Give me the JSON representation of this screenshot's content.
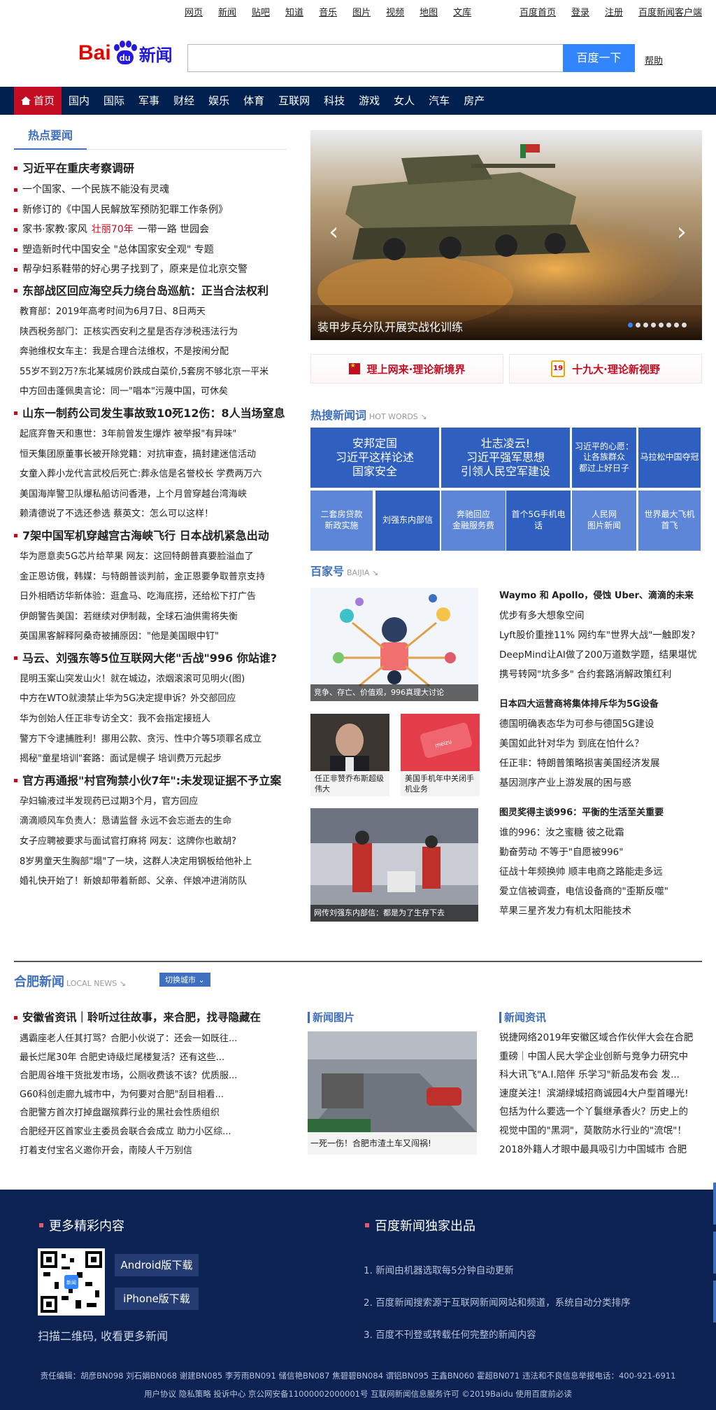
{
  "topnav": {
    "items": [
      "网页",
      "新闻",
      "贴吧",
      "知道",
      "音乐",
      "图片",
      "视频",
      "地图",
      "文库"
    ],
    "right": [
      "百度首页",
      "登录",
      "注册",
      "百度新闻客户端"
    ]
  },
  "header": {
    "logo_bai": "Bai",
    "logo_du": "du",
    "logo_xinwen": "新闻",
    "search_button": "百度一下",
    "help": "帮助",
    "search_value": ""
  },
  "mainnav": {
    "items": [
      "首页",
      "国内",
      "国际",
      "军事",
      "财经",
      "娱乐",
      "体育",
      "互联网",
      "科技",
      "游戏",
      "女人",
      "汽车",
      "房产"
    ]
  },
  "hot_news": {
    "title": "热点要闻",
    "top": [
      {
        "text": "习近平在重庆考察调研",
        "bold": true
      },
      {
        "text": "一个国家、一个民族不能没有灵魂"
      },
      {
        "text": "新修订的《中国人民解放军预防犯罪工作条例》"
      },
      {
        "text": "家书·家教·家风",
        "red": "壮丽70年",
        "rest": "一带一路  世园会"
      },
      {
        "text": "塑造新时代中国安全 \"总体国家安全观\" 专题"
      },
      {
        "text": "帮孕妇系鞋带的好心男子找到了，原来是位北京交警"
      }
    ],
    "groups": [
      {
        "head": "东部战区回应海空兵力绕台岛巡航：正当合法权利",
        "items": [
          "教育部：2019年高考时间为6月7日、8日两天",
          "陕西税务部门：正核实西安利之星是否存涉税违法行为",
          "奔驰维权女车主：我是合理合法维权，不是按闹分配",
          "55岁不到2万?东北某城房价跌成白菜价,5套房不够北京一平米",
          "中方回击蓬佩奥言论：同一\"唱本\"污蔑中国，可休矣"
        ]
      },
      {
        "head": "山东一制药公司发生事故致10死12伤：8人当场窒息",
        "items": [
          "起底弃鲁天和惠世：3年前曾发生爆炸 被举报\"有异味\"",
          "恒天集团原董事长被开除党籍：对抗审查，搞封建迷信活动",
          "女童入葬小龙代言武校后死亡:葬永信是名誉校长 学费两万六",
          "美国海岸警卫队爆私船访问香港，上个月曾穿越台湾海峡",
          "赖清德说了不选还参选 蔡英文：怎么可以这样！"
        ]
      },
      {
        "head": "7架中国军机穿越宫古海峡飞行 日本战机紧急出动",
        "items": [
          "华为愿意卖5G芯片给苹果 网友：这回特朗普真要脸溢血了",
          "金正恩访俄，韩媒：与特朗普谈判前，金正恩要争取普京支持",
          "日外相晒访华新体验：逛盒马、吃海底捞，还给松下打广告",
          "伊朗警告美国：若继续对伊制裁，全球石油供需将失衡",
          "英国黑客解释阿桑奇被捕原因：\"他是美国眼中钉\""
        ]
      },
      {
        "head": "马云、刘强东等5位互联网大佬\"舌战\"996 你站谁?",
        "items": [
          "昆明玉案山突发山火！就在城边，浓烟滚滚可见明火(图)",
          "中方在WTO就澳禁止华为5G决定提申诉？外交部回应",
          "华为创始人任正非专访全文：我不会指定接班人",
          "警方下令逮捕胜利！挪用公款、贪污、性中介等5项罪名成立",
          "揭秘\"童星培训\"套路：面试是幌子 培训费万元起步"
        ]
      },
      {
        "head": "官方再通报\"村官殉禁小伙7年\":未发现证据不予立案",
        "items": [
          "孕妇输液过半发现药已过期3个月，官方回应",
          "滴滴顺风车负责人：恳请监督 永远不会忘逝去的生命",
          "女子应聘被要求与面试官打麻将 网友：这牌你也敢胡?",
          "8岁男童天生胸部\"塌\"了一块，这群人决定用钢板给他补上",
          "婚礼快开始了！新娘却带着新郎、父亲、伴娘冲进消防队"
        ]
      }
    ]
  },
  "carousel": {
    "caption": "装甲步兵分队开展实战化训练",
    "prev": "‹",
    "next": "›",
    "count": 8,
    "active": 0
  },
  "banners": [
    {
      "label": "理上网来·理论新境界"
    },
    {
      "label": "十九大·理论新视野"
    }
  ],
  "hotwords": {
    "title": "热搜新闻词",
    "sub": "HOT WORDS ↘",
    "cells": [
      "安邦定国\n习近平这样论述\n国家安全",
      "壮志凌云!\n习近平强军思想\n引领人民空军建设",
      "习近平的心愿：\n让各族群众\n都过上好日子",
      "马拉松中国夺冠",
      "二套房贷款\n新政实施",
      "刘强东内部信",
      "奔驰回应\n金融服务费",
      "首个5G手机电话",
      "人民网\n图片新闻",
      "世界最大飞机\n首飞"
    ]
  },
  "baijia": {
    "title": "百家号",
    "sub": "BAIJIA ↘",
    "img1_cap": "竞争、存亡、价值观，996真理大讨论",
    "img2_cap": "任正非赞乔布斯超级伟大",
    "img3_cap": "美国手机年中关闭手机业务",
    "img3_brand": "meizu",
    "img4_cap": "网传刘强东内部信：都是为了生存下去",
    "group1": [
      "Waymo 和 Apollo，侵蚀 Uber、滴滴的未来",
      "优步有多大想象空间",
      "Lyft股价重挫11% 网约车\"世界大战\"一触即发?",
      "DeepMind让AI做了200万道数学题，结果堪忧",
      "携号转网\"坑多多\" 合约套路消解政策红利"
    ],
    "group2": [
      "日本四大运营商将集体排斥华为5G设备",
      "德国明确表态华为可参与德国5G建设",
      "美国如此针对华为 到底在怕什么？",
      "任正非：特朗普策略损害美国经济发展",
      "基因测序产业上游发展的困与惑"
    ],
    "group3": [
      "图灵奖得主谈996：平衡的生活至关重要",
      "谁的996：汝之蜜糖 彼之砒霜",
      "勤奋劳动 不等于\"自愿被996\"",
      "征战十年频换帅 顺丰电商之路能走多远",
      "爱立信被调查，电信设备商的\"歪斯反噬\"",
      "苹果三星齐发力有机太阳能技术"
    ]
  },
  "local": {
    "title": "合肥新闻",
    "sub": "LOCAL NEWS ↘",
    "switch": "切换城市 ⌄",
    "head": "安徽省资讯｜聆听过往故事，来合肥，找寻隐藏在",
    "items": [
      "遇霸座老人任其打骂？合肥小伙说了：还会一如既往...",
      "最长烂尾30年 合肥史诗级烂尾楼复活？还有这些...",
      "合肥周谷堆干货批发市场，公厕收费该不该？优质服...",
      "G60科创走廊九城市中，为何要对合肥\"刮目相看...",
      "合肥警方首次打掉盘踞殡葬行业的黑社会性质组织",
      "合肥经开区首家业主委员会联合会成立 助力小区综...",
      "打着支付宝名义邀你开会，南陵人千万别信"
    ],
    "pic_title": "新闻图片",
    "pic_cap": "一死一伤！合肥市渣土车又闯祸!",
    "info_title": "新闻资讯",
    "info": [
      "锐捷网络2019年安徽区域合作伙伴大会在合肥",
      "重磅｜中国人民大学企业创新与竞争力研究中",
      "科大讯飞\"A.I.陪伴 乐学习\"新品发布会 发...",
      "速度关注！滨湖绿城招商诚园4大户型首曝光!",
      "包括为什么要选一个丫鬟继承香火？历史上的",
      "视觉中国的\"黑洞\"，莫散防水行业的\"流氓\"！",
      "2018外籍人才眼中最具吸引力中国城市 合肥"
    ]
  },
  "footer": {
    "left_title": "更多精彩内容",
    "android": "Android版下载",
    "iphone": "iPhone版下载",
    "scan": "扫描二维码, 收看更多新闻",
    "qr_label": "新闻",
    "right_title": "百度新闻独家出品",
    "points": [
      "1. 新闻由机器选取每5分钟自动更新",
      "2. 百度新闻搜索源于互联网新闻网站和频道，系统自动分类排序",
      "3. 百度不刊登或转载任何完整的新闻内容"
    ],
    "editors": "责任编辑：胡彦BN098 刘石娟BN068 谢建BN085 李芳雨BN091 储信艳BN087 焦碧碧BN084 谓铝BN095 王鑫BN060 霍超BN071 违法和不良信息举报电话：400-921-6911",
    "copyright": "用户协议 隐私策略 投诉中心 京公网安备11000002000001号 互联网新闻信息服务许可 ©2019Baidu 使用百度前必读"
  }
}
